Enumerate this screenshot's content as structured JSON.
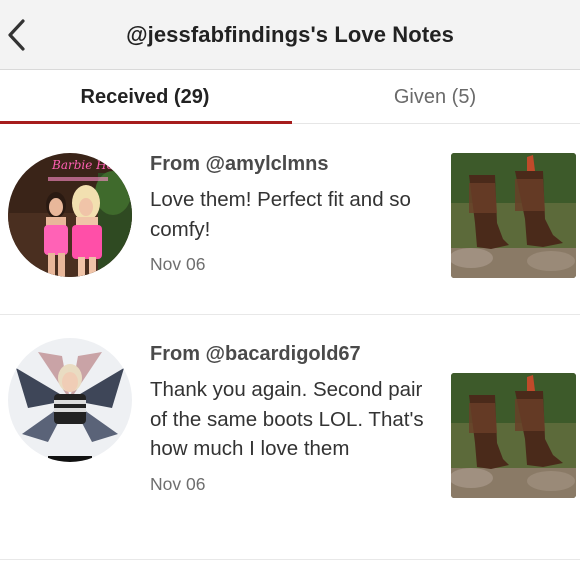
{
  "header": {
    "title": "@jessfabfindings's Love Notes"
  },
  "tabs": {
    "received": "Received (29)",
    "given": "Given (5)"
  },
  "notes": [
    {
      "from": "From @amylclmns",
      "message": "Love them! Perfect fit and so comfy!",
      "date": "Nov 06",
      "avatar_sign": "Barbie Hotel"
    },
    {
      "from": "From @bacardigold67",
      "message": "Thank you again. Second pair of the same boots LOL. That's how much I love them",
      "date": "Nov 06"
    }
  ],
  "colors": {
    "accent": "#a61c1c",
    "header_bg": "#f3f3f3",
    "neon_pink": "#ff5fb3"
  },
  "icons": {
    "back": "chevron-left-icon"
  }
}
